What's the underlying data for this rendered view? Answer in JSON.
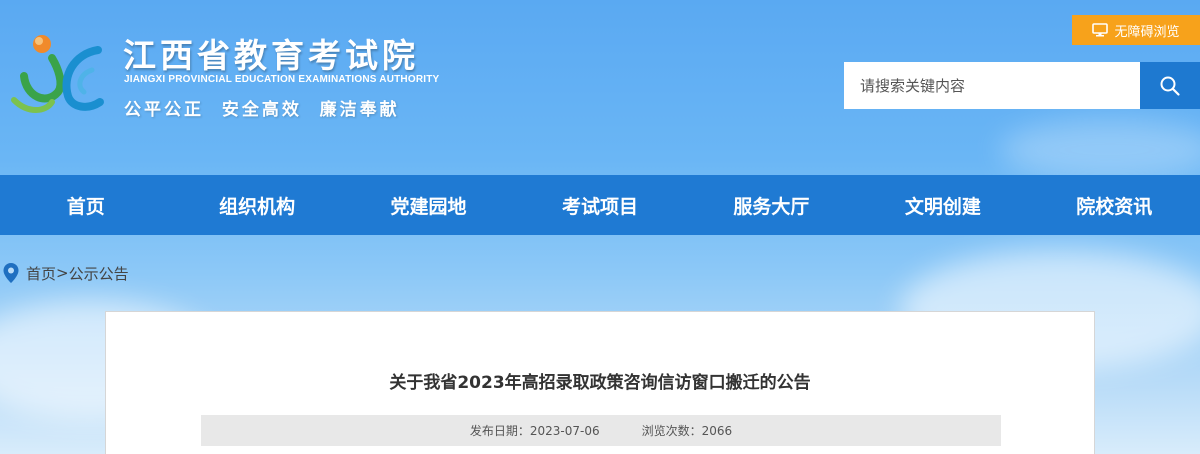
{
  "header": {
    "title": "江西省教育考试院",
    "subtitle_en": "JIANGXI PROVINCIAL EDUCATION EXAMINATIONS AUTHORITY",
    "slogan": "公平公正  安全高效  廉洁奉献",
    "accessibility_label": "无障碍浏览",
    "search": {
      "placeholder": "请搜索关键内容",
      "value": ""
    }
  },
  "nav": {
    "items": [
      {
        "label": "首页"
      },
      {
        "label": "组织机构"
      },
      {
        "label": "党建园地"
      },
      {
        "label": "考试项目"
      },
      {
        "label": "服务大厅"
      },
      {
        "label": "文明创建"
      },
      {
        "label": "院校资讯"
      }
    ]
  },
  "breadcrumb": {
    "home": "首页",
    "separator": ">",
    "current": "公示公告"
  },
  "article": {
    "title": "关于我省2023年高招录取政策咨询信访窗口搬迁的公告",
    "date_label": "发布日期：",
    "date": "2023-07-06",
    "views_label": "浏览次数：",
    "views": "2066"
  },
  "colors": {
    "nav_bg": "#1f7ad3",
    "accessibility_bg": "#f7a21b",
    "search_button_bg": "#1e79d0"
  },
  "icons": {
    "accessibility": "monitor-icon",
    "search": "search-icon",
    "breadcrumb": "location-pin-icon",
    "logo": "jx-logo-icon"
  }
}
